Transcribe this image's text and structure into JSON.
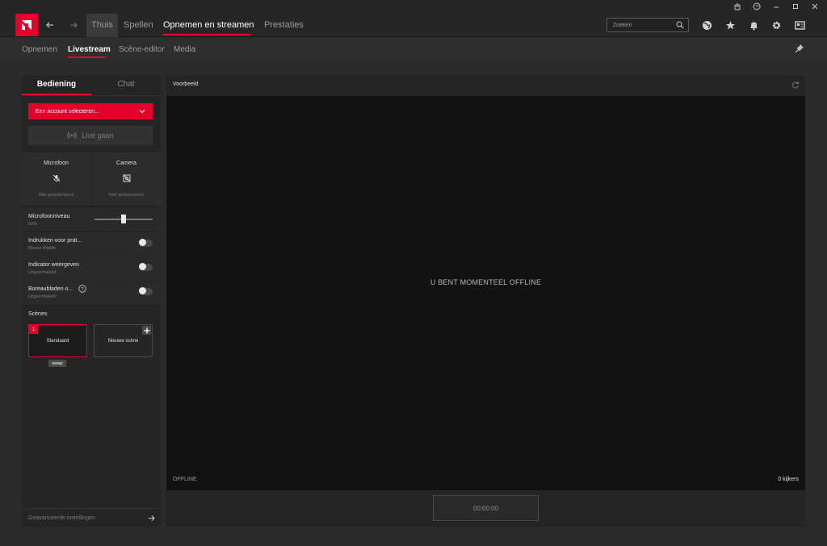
{
  "nav": {
    "thuis": "Thuis",
    "spellen": "Spellen",
    "opnemen": "Opnemen en streamen",
    "prestaties": "Prestaties",
    "search_placeholder": "Zoeken"
  },
  "subnav": {
    "opnemen": "Opnemen",
    "livestream": "Livestream",
    "scene_editor": "Scène-editor",
    "media": "Media"
  },
  "left": {
    "tab_bediening": "Bediening",
    "tab_chat": "Chat",
    "account_select": "Een account selecteren...",
    "live_button": "Live gaan",
    "microfoon": {
      "label": "Microfoon",
      "status": "Niet gedetecteerd"
    },
    "camera": {
      "label": "Camera",
      "status": "Niet gedetecteerd"
    },
    "mic_level": {
      "label": "Microfoonniveau",
      "value_text": "50%",
      "value": 0.5
    },
    "push_to_talk": {
      "label": "Indrukken voor prat...",
      "sub": "Mouse Middle"
    },
    "indicator": {
      "label": "Indicator weergeven",
      "sub": "Uitgeschakeld"
    },
    "desktop": {
      "label": "Bureaubladen o...",
      "sub": "Uitgeschakeld"
    },
    "scenes_title": "Scènes",
    "scene1": {
      "num": "1",
      "name": "Standaard",
      "badge": "NONE"
    },
    "scene_new": "Nieuwe scène",
    "advanced": "Geavanceerde instellingen"
  },
  "preview": {
    "title": "Voorbeeld",
    "offline_message": "U BENT MOMENTEEL OFFLINE",
    "status": "OFFLINE",
    "viewers": "0 kijkers",
    "timer": "00:00:00"
  },
  "colors": {
    "accent": "#e4002b",
    "background": "#2b2b2b",
    "panel": "#252525",
    "preview": "#121212"
  }
}
